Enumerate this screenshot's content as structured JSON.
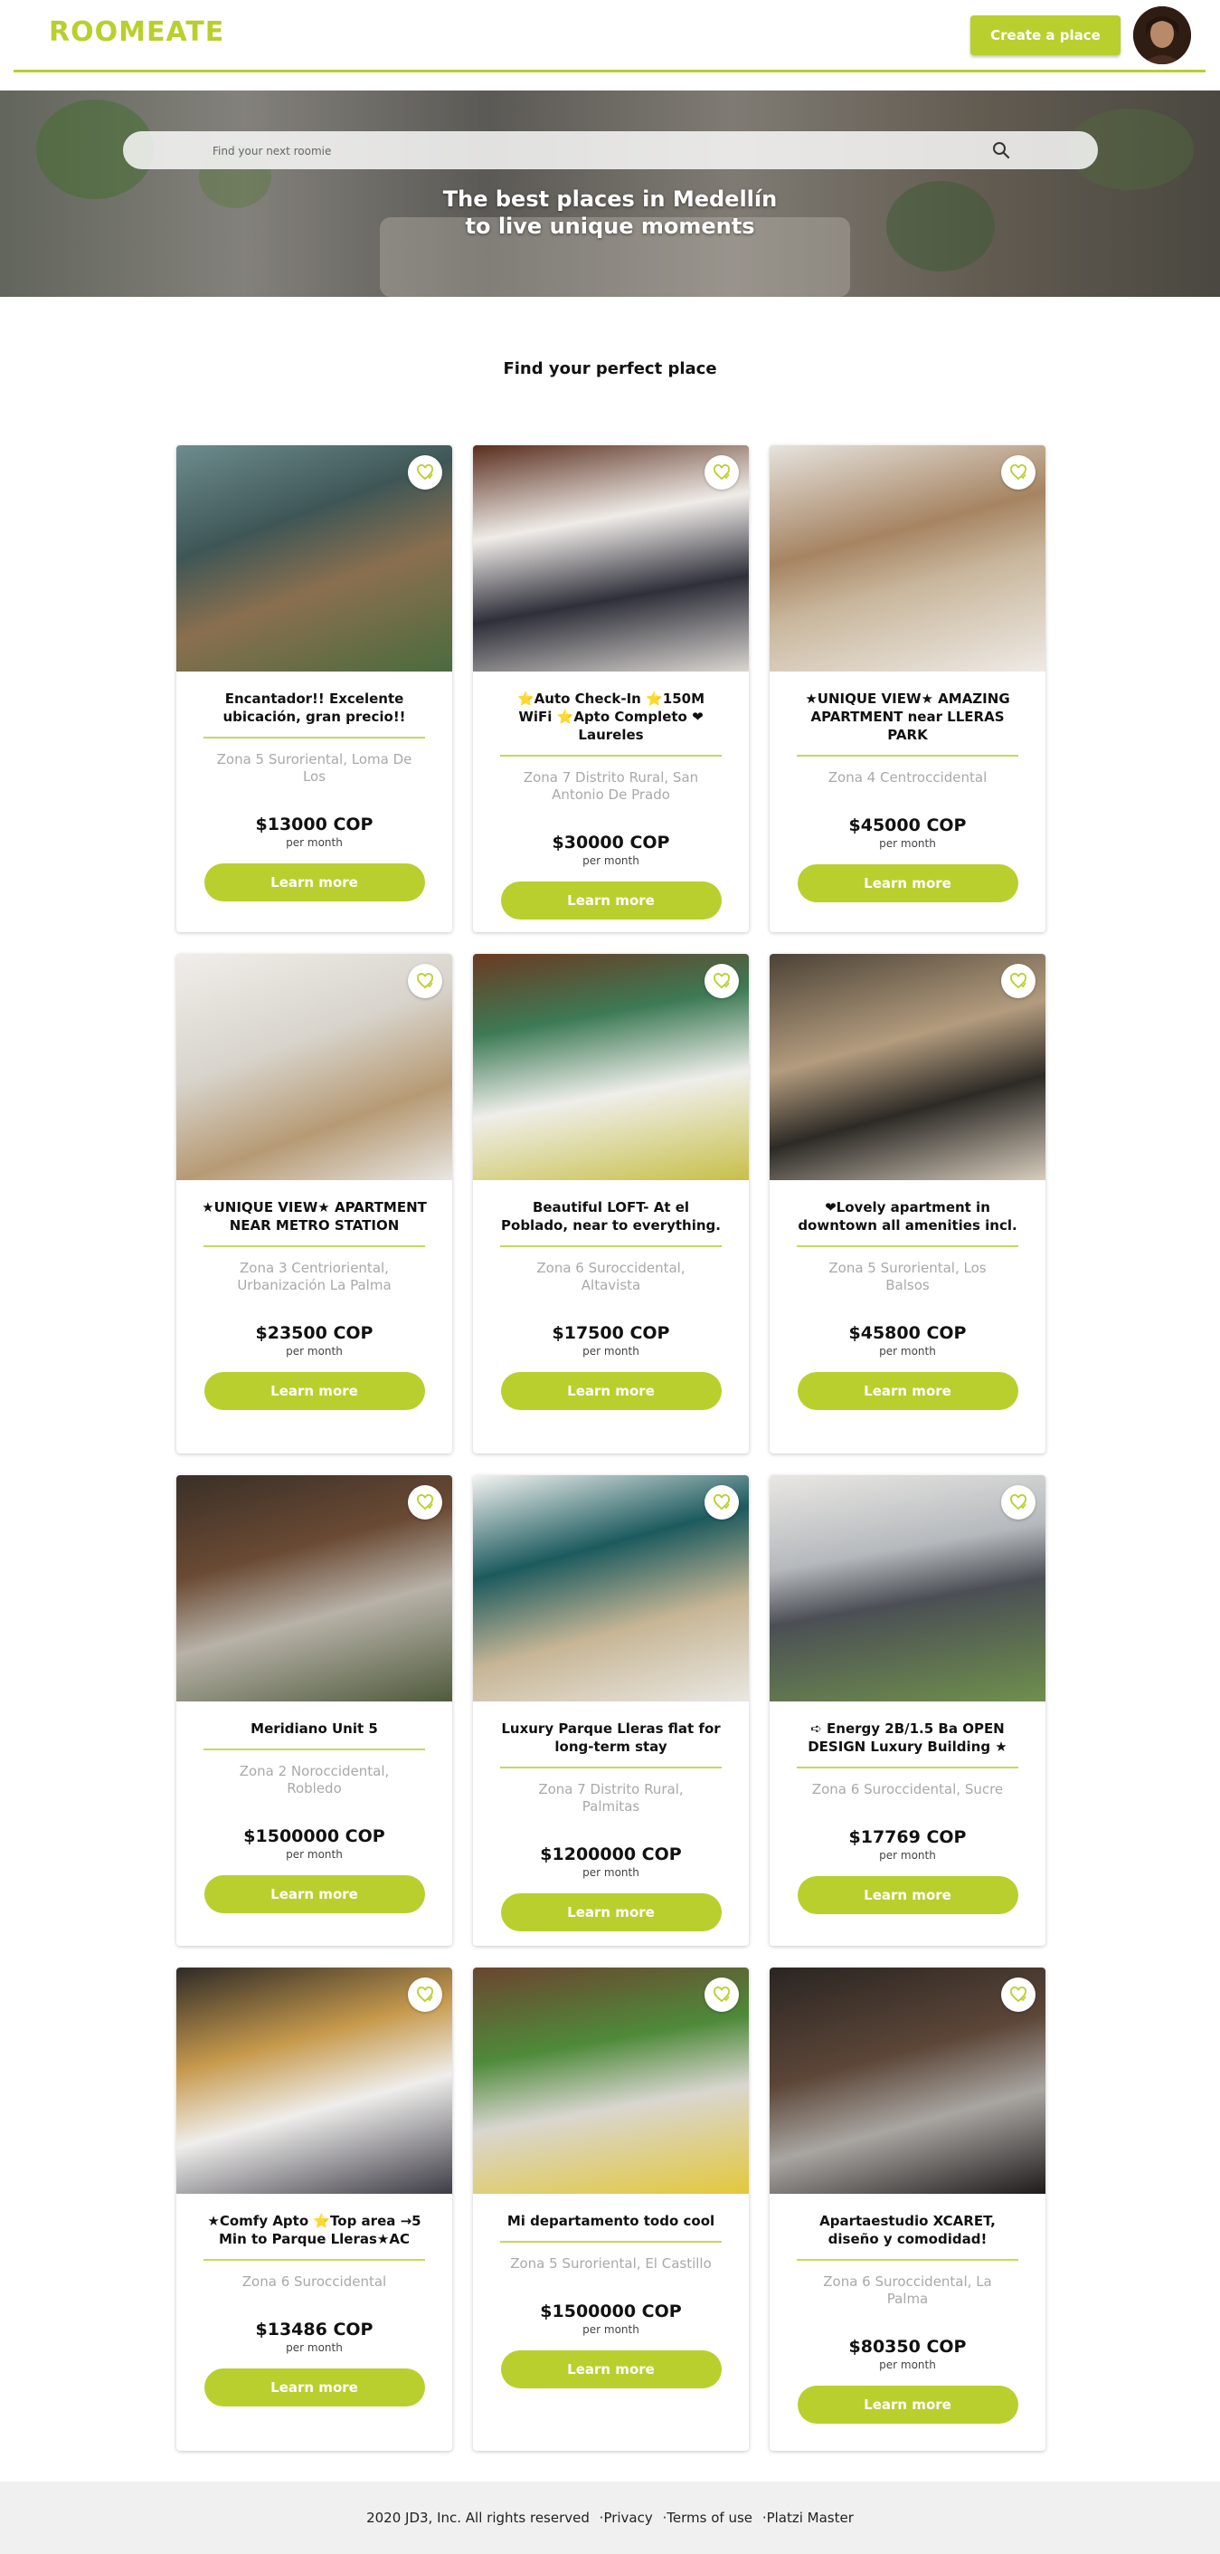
{
  "header": {
    "logo": "ROOMEATE",
    "create_label": "Create a place"
  },
  "hero": {
    "search_placeholder": "Find your next roomie",
    "title_line1": "The best places in Medellín",
    "title_line2": "to live unique moments"
  },
  "section_title": "Find your perfect place",
  "colors": {
    "accent": "#b9cf2e",
    "zone_text": "#a9a9a9",
    "footer_bg": "#f0f0f0"
  },
  "cards": [
    {
      "title": "Encantador!! Excelente ubicación, gran precio!!",
      "zone": "Zona 5 Suroriental, Loma De Los",
      "price": "$13000 COP",
      "period": "per month",
      "button": "Learn more"
    },
    {
      "title": "⭐Auto Check-In ⭐150M WiFi ⭐Apto Completo ❤Laureles",
      "zone": "Zona 7 Distrito Rural, San Antonio De Prado",
      "price": "$30000 COP",
      "period": "per month",
      "button": "Learn more"
    },
    {
      "title": "★UNIQUE VIEW★ AMAZING APARTMENT near LLERAS PARK",
      "zone": "Zona 4 Centroccidental",
      "price": "$45000 COP",
      "period": "per month",
      "button": "Learn more"
    },
    {
      "title": "★UNIQUE VIEW★ APARTMENT NEAR METRO STATION",
      "zone": "Zona 3 Centrioriental, Urbanización La Palma",
      "price": "$23500 COP",
      "period": "per month",
      "button": "Learn more"
    },
    {
      "title": "Beautiful LOFT- At el Poblado, near to everything.",
      "zone": "Zona 6 Suroccidental, Altavista",
      "price": "$17500 COP",
      "period": "per month",
      "button": "Learn more"
    },
    {
      "title": "❤Lovely apartment in downtown all amenities incl.",
      "zone": "Zona 5 Suroriental, Los Balsos",
      "price": "$45800 COP",
      "period": "per month",
      "button": "Learn more"
    },
    {
      "title": "Meridiano Unit 5",
      "zone": "Zona 2 Noroccidental, Robledo",
      "price": "$1500000 COP",
      "period": "per month",
      "button": "Learn more"
    },
    {
      "title": "Luxury Parque Lleras flat for long-term stay",
      "zone": "Zona 7 Distrito Rural, Palmitas",
      "price": "$1200000 COP",
      "period": "per month",
      "button": "Learn more"
    },
    {
      "title": "➪ Energy 2B/1.5 Ba OPEN DESIGN Luxury Building ★",
      "zone": "Zona 6 Suroccidental, Sucre",
      "price": "$17769 COP",
      "period": "per month",
      "button": "Learn more"
    },
    {
      "title": "★Comfy Apto ⭐Top area →5 Min to Parque Lleras★AC",
      "zone": "Zona 6 Suroccidental",
      "price": "$13486 COP",
      "period": "per month",
      "button": "Learn more"
    },
    {
      "title": "Mi departamento todo cool",
      "zone": "Zona 5 Suroriental, El Castillo",
      "price": "$1500000 COP",
      "period": "per month",
      "button": "Learn more"
    },
    {
      "title": "Apartaestudio XCARET, diseño y comodidad!",
      "zone": "Zona 6 Suroccidental, La Palma",
      "price": "$80350 COP",
      "period": "per month",
      "button": "Learn more"
    }
  ],
  "footer": {
    "copyright": "2020 JD3, Inc. All rights reserved",
    "privacy": "·Privacy",
    "terms": "·Terms of use",
    "platzi": "·Platzi Master"
  }
}
